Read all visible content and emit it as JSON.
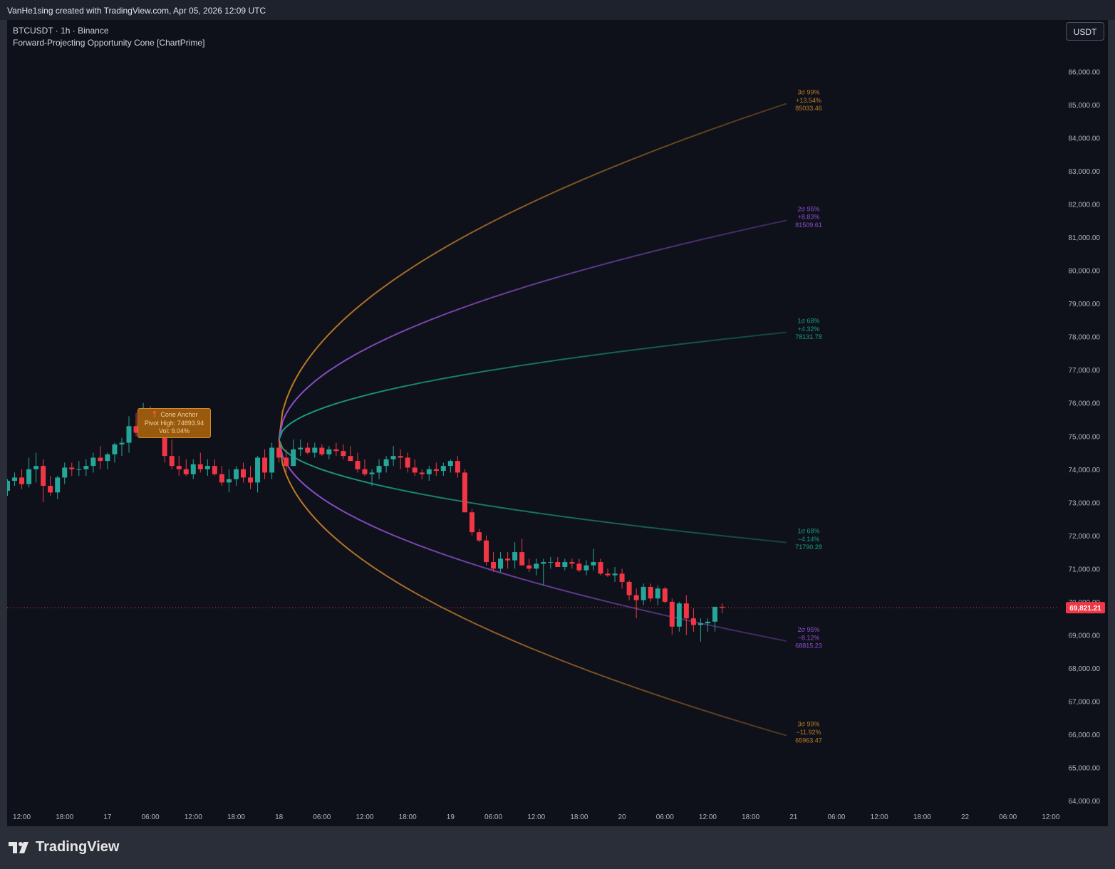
{
  "header": {
    "credit": "VanHe1sing created with TradingView.com, Apr 05, 2026 12:09 UTC"
  },
  "legend": {
    "symbol": "BTCUSDT · 1h · Binance",
    "indicator": "Forward-Projecting Opportunity Cone [ChartPrime]"
  },
  "currency_button": "USDT",
  "anchor": {
    "line1": "📍 Cone Anchor",
    "line2": "Pivot High: 74893.94",
    "line3": "Vol: 9.04%"
  },
  "footer": {
    "brand": "TradingView",
    "logo_icon": "tradingview-logo-icon"
  },
  "colors": {
    "background": "#0e111a",
    "up": "#26a69a",
    "down": "#f23645",
    "sigma3": "#c27b26",
    "sigma2": "#8e4fd0",
    "sigma1": "#1b9c85",
    "last_price": "#f23645"
  },
  "chart_data": {
    "type": "candlestick",
    "symbol": "BTCUSDT",
    "timeframe": "1h",
    "exchange": "Binance",
    "ylim": [
      63800,
      87200
    ],
    "y_ticks": [
      64000,
      65000,
      66000,
      67000,
      68000,
      69000,
      70000,
      71000,
      72000,
      73000,
      74000,
      75000,
      76000,
      77000,
      78000,
      79000,
      80000,
      81000,
      82000,
      83000,
      84000,
      85000,
      86000
    ],
    "y_tick_labels": [
      "64,000.00",
      "65,000.00",
      "66,000.00",
      "67,000.00",
      "68,000.00",
      "69,000.00",
      "70,000.00",
      "71,000.00",
      "72,000.00",
      "73,000.00",
      "74,000.00",
      "75,000.00",
      "76,000.00",
      "77,000.00",
      "78,000.00",
      "79,000.00",
      "80,000.00",
      "81,000.00",
      "82,000.00",
      "83,000.00",
      "84,000.00",
      "85,000.00",
      "86,000.00"
    ],
    "x_ticks": [
      {
        "bar": 2,
        "label": "12:00"
      },
      {
        "bar": 8,
        "label": "18:00"
      },
      {
        "bar": 14,
        "label": "17"
      },
      {
        "bar": 20,
        "label": "06:00"
      },
      {
        "bar": 26,
        "label": "12:00"
      },
      {
        "bar": 32,
        "label": "18:00"
      },
      {
        "bar": 38,
        "label": "18"
      },
      {
        "bar": 44,
        "label": "06:00"
      },
      {
        "bar": 50,
        "label": "12:00"
      },
      {
        "bar": 56,
        "label": "18:00"
      },
      {
        "bar": 62,
        "label": "19"
      },
      {
        "bar": 68,
        "label": "06:00"
      },
      {
        "bar": 74,
        "label": "12:00"
      },
      {
        "bar": 80,
        "label": "18:00"
      },
      {
        "bar": 86,
        "label": "20"
      },
      {
        "bar": 92,
        "label": "06:00"
      },
      {
        "bar": 98,
        "label": "12:00"
      },
      {
        "bar": 104,
        "label": "18:00"
      },
      {
        "bar": 110,
        "label": "21"
      },
      {
        "bar": 116,
        "label": "06:00"
      },
      {
        "bar": 122,
        "label": "12:00"
      },
      {
        "bar": 128,
        "label": "18:00"
      },
      {
        "bar": 134,
        "label": "22"
      },
      {
        "bar": 140,
        "label": "06:00"
      },
      {
        "bar": 146,
        "label": "12:00"
      }
    ],
    "candles": [
      [
        73350,
        73700,
        73200,
        73650
      ],
      [
        73650,
        73900,
        73500,
        73750
      ],
      [
        73750,
        74000,
        73400,
        73550
      ],
      [
        73550,
        74350,
        73450,
        74000
      ],
      [
        74000,
        74500,
        73600,
        74100
      ],
      [
        74100,
        74300,
        73000,
        73500
      ],
      [
        73500,
        73800,
        73200,
        73300
      ],
      [
        73300,
        73800,
        73100,
        73750
      ],
      [
        73750,
        74200,
        73550,
        74050
      ],
      [
        74050,
        74200,
        73800,
        74000
      ],
      [
        74000,
        74250,
        73800,
        74000
      ],
      [
        74000,
        74300,
        73800,
        74100
      ],
      [
        74100,
        74500,
        73900,
        74350
      ],
      [
        74350,
        74700,
        74000,
        74250
      ],
      [
        74250,
        74500,
        74000,
        74450
      ],
      [
        74450,
        74800,
        74200,
        74750
      ],
      [
        74750,
        74950,
        74400,
        74800
      ],
      [
        74800,
        75600,
        74500,
        75300
      ],
      [
        75300,
        75700,
        75000,
        75100
      ],
      [
        75100,
        76000,
        75100,
        75700
      ],
      [
        75700,
        75900,
        75300,
        75500
      ],
      [
        75500,
        75700,
        75000,
        75200
      ],
      [
        75200,
        75400,
        74200,
        74400
      ],
      [
        74400,
        74900,
        74000,
        74100
      ],
      [
        74100,
        74400,
        73800,
        74000
      ],
      [
        74000,
        74300,
        73800,
        73850
      ],
      [
        73850,
        74300,
        73700,
        74150
      ],
      [
        74150,
        74500,
        73900,
        74000
      ],
      [
        74000,
        74300,
        73800,
        74100
      ],
      [
        74100,
        74300,
        73800,
        73850
      ],
      [
        73850,
        74100,
        73500,
        73600
      ],
      [
        73600,
        74000,
        73300,
        73700
      ],
      [
        73700,
        74100,
        73500,
        74000
      ],
      [
        74000,
        74200,
        73600,
        73750
      ],
      [
        73750,
        74100,
        73400,
        73600
      ],
      [
        73600,
        74400,
        73300,
        74350
      ],
      [
        74350,
        74600,
        73700,
        73900
      ],
      [
        73900,
        74800,
        73700,
        74650
      ],
      [
        74650,
        74894,
        74200,
        74350
      ],
      [
        74350,
        74600,
        73900,
        74100
      ],
      [
        74100,
        74900,
        74100,
        74600
      ],
      [
        74600,
        74900,
        74400,
        74650
      ],
      [
        74650,
        74800,
        74450,
        74500
      ],
      [
        74500,
        74800,
        74350,
        74650
      ],
      [
        74650,
        74750,
        74400,
        74450
      ],
      [
        74450,
        74700,
        74300,
        74600
      ],
      [
        74600,
        74800,
        74400,
        74550
      ],
      [
        74550,
        74750,
        74300,
        74400
      ],
      [
        74400,
        74700,
        74300,
        74250
      ],
      [
        74250,
        74500,
        73900,
        74000
      ],
      [
        74000,
        74300,
        73800,
        73850
      ],
      [
        73850,
        74000,
        73500,
        73900
      ],
      [
        73900,
        74300,
        73700,
        74100
      ],
      [
        74100,
        74400,
        73900,
        74300
      ],
      [
        74300,
        74700,
        74100,
        74400
      ],
      [
        74400,
        74600,
        74000,
        74350
      ],
      [
        74350,
        74500,
        73900,
        74050
      ],
      [
        74050,
        74300,
        73800,
        73900
      ],
      [
        73900,
        74000,
        73700,
        73850
      ],
      [
        73850,
        74100,
        73650,
        74000
      ],
      [
        74000,
        74200,
        73800,
        73950
      ],
      [
        73950,
        74200,
        73800,
        74100
      ],
      [
        74100,
        74300,
        73900,
        74250
      ],
      [
        74250,
        74400,
        73750,
        73900
      ],
      [
        73900,
        74000,
        72700,
        72700
      ],
      [
        72700,
        72800,
        72000,
        72100
      ],
      [
        72100,
        72200,
        71800,
        71850
      ],
      [
        71850,
        72000,
        71100,
        71200
      ],
      [
        71200,
        71500,
        70900,
        71000
      ],
      [
        71000,
        71500,
        70900,
        71300
      ],
      [
        71300,
        71500,
        71000,
        71250
      ],
      [
        71250,
        71800,
        71000,
        71500
      ],
      [
        71500,
        71900,
        71100,
        71100
      ],
      [
        71100,
        71300,
        70900,
        71000
      ],
      [
        71000,
        71300,
        70800,
        71150
      ],
      [
        71150,
        71300,
        70500,
        71200
      ],
      [
        71200,
        71350,
        71000,
        71200
      ],
      [
        71200,
        71350,
        71050,
        71050
      ],
      [
        71050,
        71300,
        70950,
        71200
      ],
      [
        71200,
        71300,
        71000,
        71150
      ],
      [
        71150,
        71300,
        70900,
        70950
      ],
      [
        70950,
        71250,
        70800,
        71100
      ],
      [
        71100,
        71600,
        70950,
        71200
      ],
      [
        71200,
        71300,
        70800,
        70850
      ],
      [
        70850,
        71000,
        70750,
        70800
      ],
      [
        70800,
        71050,
        70600,
        70850
      ],
      [
        70850,
        71000,
        70400,
        70600
      ],
      [
        70600,
        70650,
        70050,
        70200
      ],
      [
        70200,
        70400,
        69500,
        70050
      ],
      [
        70050,
        70550,
        69900,
        70450
      ],
      [
        70450,
        70550,
        70000,
        70100
      ],
      [
        70100,
        70500,
        69900,
        70400
      ],
      [
        70400,
        70450,
        69950,
        70000
      ],
      [
        70000,
        70100,
        69000,
        69250
      ],
      [
        69250,
        70000,
        69100,
        69950
      ],
      [
        69950,
        70200,
        69000,
        69500
      ],
      [
        69500,
        69800,
        69100,
        69300
      ],
      [
        69300,
        69500,
        68800,
        69350
      ],
      [
        69350,
        69500,
        69100,
        69400
      ],
      [
        69400,
        69800,
        69100,
        69850
      ],
      [
        69850,
        69950,
        69650,
        69820
      ]
    ],
    "last_price": 69821.21,
    "last_price_label": "69,821.21",
    "anchor": {
      "bar": 38,
      "price": 74893.94,
      "label": "Pivot High: 74893.94",
      "vol": "Vol: 9.04%"
    },
    "cone_end_bar": 109,
    "series": [
      {
        "name": "3σ 99%",
        "pct": "+13.54%",
        "end_value": 85033.46,
        "end_label": "85033.46",
        "color": "#c27b26"
      },
      {
        "name": "2σ 95%",
        "pct": "+8.83%",
        "end_value": 81509.61,
        "end_label": "81509.61",
        "color": "#8e4fd0"
      },
      {
        "name": "1σ 68%",
        "pct": "+4.32%",
        "end_value": 78131.78,
        "end_label": "78131.78",
        "color": "#1b9c85"
      },
      {
        "name": "1σ 68%",
        "pct": "−4.14%",
        "end_value": 71790.28,
        "end_label": "71790.28",
        "color": "#1b9c85"
      },
      {
        "name": "2σ 95%",
        "pct": "−8.12%",
        "end_value": 68815.23,
        "end_label": "68815.23",
        "color": "#8e4fd0"
      },
      {
        "name": "3σ 99%",
        "pct": "−11.92%",
        "end_value": 65963.47,
        "end_label": "65963.47",
        "color": "#c27b26"
      }
    ]
  }
}
